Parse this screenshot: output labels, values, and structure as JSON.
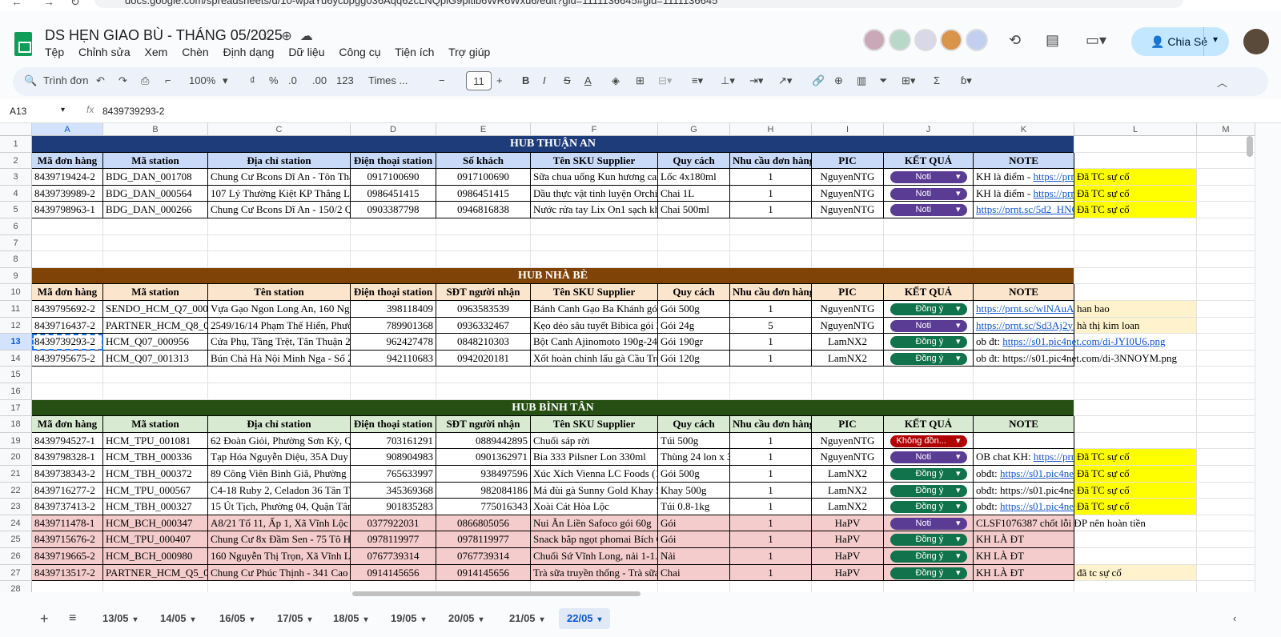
{
  "url": "docs.google.com/spreadsheets/d/10-wpaYu6ycbpgg036Aqq62cLNQpiG9pitib6WR6Wxu6/edit?gid=1111136645#gid=1111136645",
  "doc": {
    "title": "DS HẸN GIAO BÙ - THÁNG 05/2025",
    "menus": [
      "Tệp",
      "Chỉnh sửa",
      "Xem",
      "Chèn",
      "Định dạng",
      "Dữ liệu",
      "Công cụ",
      "Tiện ích",
      "Trợ giúp"
    ],
    "share_label": "Chia Sẻ"
  },
  "toolbar": {
    "search_label": "Trình đơn",
    "zoom": "100%",
    "currency": "₫",
    "percent": "%",
    "dec_less": ".0",
    "dec_more": ".00",
    "format_123": "123",
    "font": "Times ...",
    "font_size": "11"
  },
  "formula": {
    "cell_ref": "A13",
    "value": "8439739293-2"
  },
  "columns": [
    "A",
    "B",
    "C",
    "D",
    "E",
    "F",
    "G",
    "H",
    "I",
    "J",
    "K",
    "L",
    "M"
  ],
  "row_numbers": [
    "1",
    "2",
    "3",
    "4",
    "5",
    "6",
    "7",
    "8",
    "9",
    "10",
    "11",
    "12",
    "13",
    "14",
    "15",
    "16",
    "17",
    "18",
    "19",
    "20",
    "21",
    "22",
    "23",
    "24",
    "25",
    "26",
    "27",
    "28"
  ],
  "hubs": {
    "thuan_an": {
      "title": "HUB THUẬN AN",
      "headers": [
        "Mã đơn hàng",
        "Mã station",
        "Địa chỉ station",
        "Điện thoại station",
        "Số khách",
        "Tên SKU Supplier",
        "Quy cách",
        "Nhu cầu đơn hàng",
        "PIC",
        "KẾT QUẢ",
        "NOTE"
      ],
      "rows": [
        [
          "8439719424-2",
          "BDG_DAN_001708",
          "Chung Cư Bcons Dĩ An - Tôn Thất Thuyết",
          "0917100690",
          "0917100690",
          "Sữa chua uống Kun hương cam",
          "Lốc 4x180ml",
          "1",
          "NguyenNTG",
          "Noti",
          "KH là điểm - ",
          "https://prnt.sc",
          "Đã TC sự cố"
        ],
        [
          "8439739989-2",
          "BDG_DAN_000564",
          "107 Lý Thường Kiệt KP Thắng Lợi",
          "0986451415",
          "0986451415",
          "Dầu thực vật tinh luyện Orchid",
          "Chai 1L",
          "1",
          "NguyenNTG",
          "Noti",
          "KH là điểm - ",
          "https://prnt.sc",
          "Đã TC sự cố"
        ],
        [
          "8439798963-1",
          "BDG_DAN_000266",
          "Chung Cư Bcons Dĩ An - 150/2 Quốc Lộ",
          "0903387798",
          "0946816838",
          "Nước rửa tay Lix On1 sạch khuẩn",
          "Chai 500ml",
          "1",
          "NguyenNTG",
          "Noti",
          "",
          "https://prnt.sc/5d2_HNC",
          "Đã TC sự cố"
        ]
      ]
    },
    "nha_be": {
      "title": "HUB NHÀ BÈ",
      "headers": [
        "Mã đơn hàng",
        "Mã station",
        "Tên station",
        "Điện thoại station",
        "SĐT người nhận",
        "Tên SKU Supplier",
        "Quy cách",
        "Nhu cầu đơn hàng",
        "PIC",
        "KẾT QUẢ",
        "NOTE"
      ],
      "rows": [
        [
          "8439795692-2",
          "SENDO_HCM_Q7_000",
          "Vựa Gạo Ngon Long An, 160 Nguyễn",
          "398118409",
          "0963583539",
          "Bánh Canh Gạo Ba Khánh gói",
          "Gói 500g",
          "1",
          "NguyenNTG",
          "Đồng ý",
          "",
          "https://prnt.sc/wlNAuA",
          "han bao"
        ],
        [
          "8439716437-2",
          "PARTNER_HCM_Q8_0",
          "2549/16/14 Phạm Thế Hiển, Phường 7",
          "789901368",
          "0936332467",
          "Kẹo dẻo sâu tuyết Bibica gói 24g",
          "Gói 24g",
          "5",
          "NguyenNTG",
          "Noti",
          "",
          "https://prnt.sc/Sd3Aj2yl",
          "hà thị kim loan"
        ],
        [
          "8439739293-2",
          "HCM_Q07_000956",
          "Cửa Phụ, Tầng Trệt, Tân Thuận 2",
          "962427478",
          "0848210303",
          "Bột Canh Ajinomoto 190g-24",
          "Gói 190gr",
          "1",
          "LamNX2",
          "Đồng ý",
          "ob đt: ",
          "https://s01.pic4net.com/di-JYI0U6.png",
          ""
        ],
        [
          "8439795675-2",
          "HCM_Q07_001313",
          "Bún Chả Hà Nội Minh Nga - Số 2",
          "942110683",
          "0942020181",
          "Xốt hoàn chỉnh lẩu gà Cầu Tre",
          "Gói 120g",
          "1",
          "LamNX2",
          "Đồng ý",
          "ob đt: https://s01.pic4net.com/di-3NNOYM.png",
          "",
          ""
        ]
      ]
    },
    "binh_tan": {
      "title": "HUB BÌNH TÂN",
      "headers": [
        "Mã đơn hàng",
        "Mã station",
        "Địa chỉ station",
        "Điện thoại station",
        "SĐT người nhận",
        "Tên SKU Supplier",
        "Quy cách",
        "Nhu cầu đơn hàng",
        "PIC",
        "KẾT QUẢ",
        "NOTE"
      ],
      "rows": [
        [
          "8439794527-1",
          "HCM_TPU_001081",
          "62 Đoàn Giỏi, Phường Sơn Kỳ, Quận",
          "703161291",
          "0889442895",
          "Chuối sáp rời",
          "Túi 500g",
          "1",
          "NguyenNTG",
          "Không đồn...",
          "",
          "",
          ""
        ],
        [
          "8439798328-1",
          "HCM_TBH_000336",
          "Tạp Hóa Nguyễn Diệu, 35A Duy Tân",
          "908904983",
          "0901362971",
          "Bia 333 Pilsner Lon 330ml",
          "Thùng 24 lon x 330ml",
          "1",
          "NguyenNTG",
          "Noti",
          "OB chat KH: ",
          "https://prnt.sc",
          "Đã TC sự cố"
        ],
        [
          "8439738343-2",
          "HCM_TBH_000372",
          "89 Công Viên Bình Giã, Phường 13",
          "765633997",
          "938497596",
          "Xúc Xích Vienna LC Foods (1",
          "Gói 500g",
          "1",
          "LamNX2",
          "Đồng ý",
          "obđt: ",
          "https://s01.pic4net",
          "Đã TC sự cố"
        ],
        [
          "8439716277-2",
          "HCM_TPU_000567",
          "C4-18 Ruby 2, Celadon 36 Tân Thắng",
          "345369368",
          "982084186",
          "Má đùi gà Sunny Gold Khay 500g",
          "Khay 500g",
          "1",
          "LamNX2",
          "Đồng ý",
          "obđt: https://s01.pic4net",
          "",
          "Đã TC sự cố"
        ],
        [
          "8439737413-2",
          "HCM_TBH_000327",
          "15 Út Tịch, Phường 04, Quận Tân Bình",
          "901835283",
          "775016343",
          "Xoài Cát Hòa Lộc",
          "Túi 0.8-1kg",
          "1",
          "LamNX2",
          "Đồng ý",
          "obđt: ",
          "https://s01.pic4net",
          "Đã TC sự cố"
        ],
        [
          "8439711478-1",
          "HCM_BCH_000347",
          "A8/21 Tổ 11, Ấp 1, Xã Vĩnh Lộc A",
          "0377922031",
          "0866805056",
          " Nui Ăn Liền Safoco gói 60g",
          " Gói",
          "1",
          "HaPV",
          "Noti",
          "CLSF1076387 chốt lỗi ĐP nên hoàn tiền",
          "",
          ""
        ],
        [
          "8439715676-2",
          "HCM_TPU_000407",
          "Chung Cư 8x Đầm Sen - 75 Tô Hiệu",
          "0978119977",
          "0978119977",
          " Snack bắp ngọt phomai Bích Chi",
          " Gói",
          "1",
          "HaPV",
          "Đồng ý",
          "KH LÀ ĐT",
          "",
          ""
        ],
        [
          "8439719665-2",
          "HCM_BCH_000980",
          "160 Nguyễn Thị Trọn, Xã Vĩnh Lộc A",
          "0767739314",
          "0767739314",
          " Chuối Sứ Vĩnh Long, nải 1-1.2kg",
          " Nải",
          "1",
          "HaPV",
          "Đồng ý",
          "KH LÀ ĐT",
          "",
          ""
        ],
        [
          "8439713517-2",
          "PARTNER_HCM_Q5_0",
          "Chung Cư Phúc Thịnh - 341 Cao Đạt",
          "0914145656",
          "0914145656",
          "Trà sữa truyền thống - Trà sữa",
          "Chai",
          "1",
          "HaPV",
          "Đồng ý",
          "KH LÀ ĐT",
          "",
          "đã tc sự cố"
        ]
      ]
    }
  },
  "sheets": [
    "13/05",
    "14/05",
    "16/05",
    "17/05",
    "18/05",
    "19/05",
    "20/05",
    "21/05",
    "22/05"
  ],
  "active_sheet": "22/05",
  "colors": {
    "hub1": "#1f3c7a",
    "hub2": "#7f4307",
    "hub3": "#274e13",
    "hdr1": "#c9daf8",
    "hdr2": "#fce5cd",
    "hdr3": "#d9ead3",
    "yellow": "#ffff00",
    "pink": "#f4cccc",
    "cream": "#fff2cc"
  }
}
